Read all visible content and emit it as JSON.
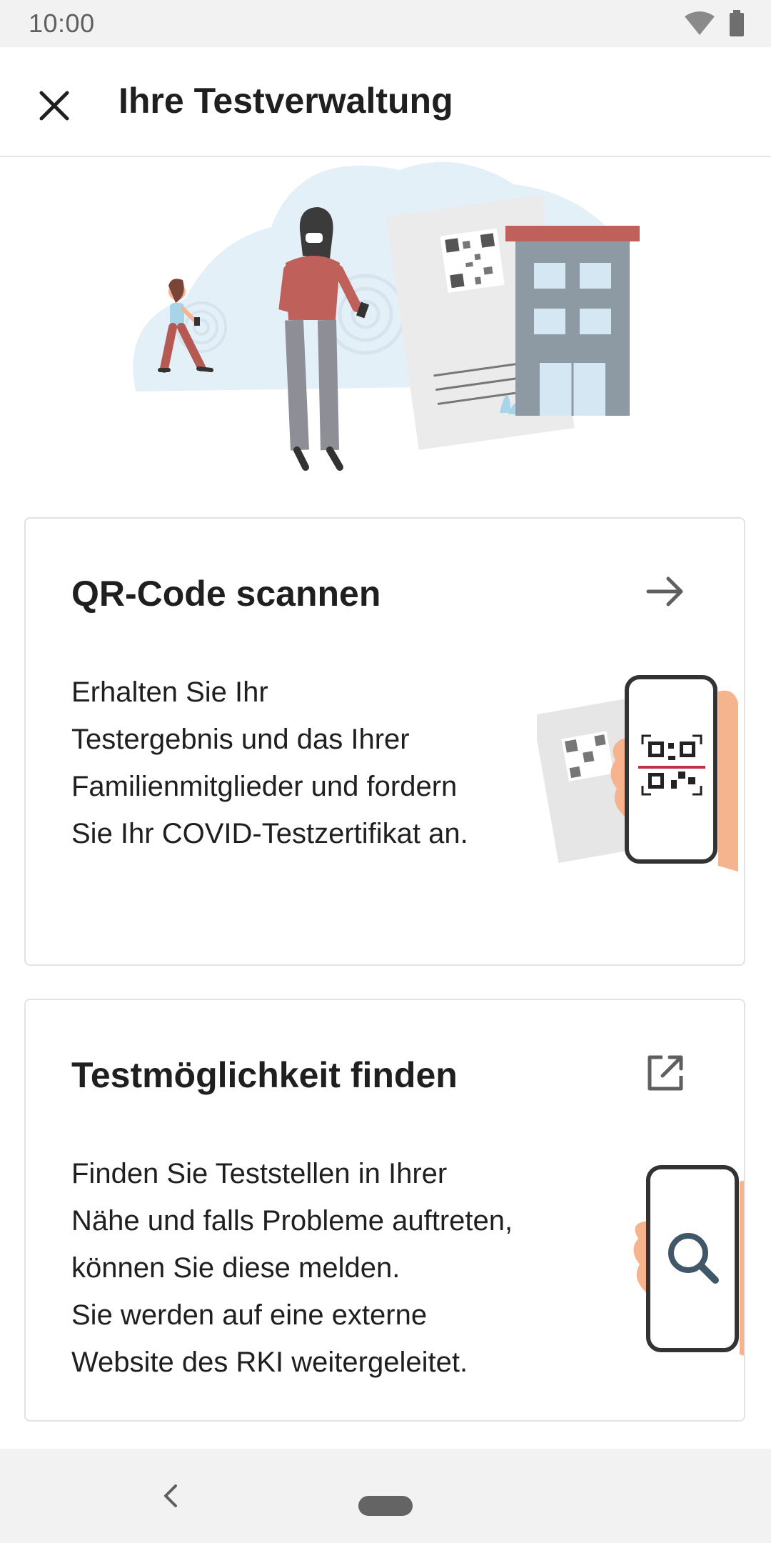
{
  "status_bar": {
    "time": "10:00",
    "icons": [
      "wifi-icon",
      "battery-icon"
    ]
  },
  "app_bar": {
    "title": "Ihre Testverwaltung",
    "close_icon": "close-icon"
  },
  "cards": [
    {
      "title": "QR-Code scannen",
      "action_icon": "arrow-right-icon",
      "body_lines": [
        "Erhalten Sie Ihr",
        "Testergebnis und das Ihrer",
        "Familienmitglieder und fordern",
        "Sie Ihr COVID-Testzertifikat an."
      ]
    },
    {
      "title": "Testmöglichkeit finden",
      "action_icon": "external-link-icon",
      "body_lines": [
        "Finden Sie Teststellen in Ihrer",
        "Nähe und falls Probleme auftreten,",
        "können Sie diese melden.",
        "Sie werden auf eine externe",
        "Website des RKI weitergeleitet."
      ]
    }
  ],
  "colors": {
    "accent_red": "#c0605a",
    "skin": "#f5b48e",
    "building_gray": "#8e9aa3",
    "sky_blue": "#e4f0f8"
  },
  "nav_bar": {
    "icons": [
      "back-chevron-icon",
      "home-pill-icon"
    ]
  }
}
